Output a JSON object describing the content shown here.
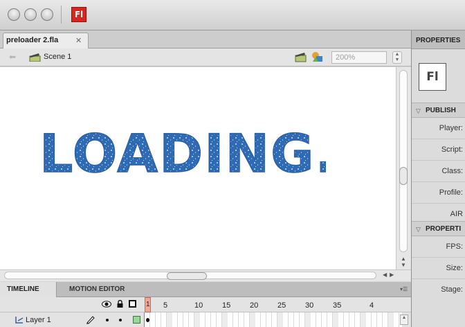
{
  "app": {
    "logo_text": "Fl"
  },
  "document": {
    "tab_name": "preloader 2.fla",
    "close_glyph": "✕"
  },
  "editbar": {
    "scene_label": "Scene 1",
    "zoom": "200%"
  },
  "stage": {
    "artwork_text": "LOADING...",
    "artwork_color": "#2f6bb5"
  },
  "timeline": {
    "tabs": [
      "TIMELINE",
      "MOTION EDITOR"
    ],
    "current_frame": "1",
    "frame_numbers": [
      "5",
      "10",
      "15",
      "20",
      "25",
      "30",
      "35",
      "4"
    ],
    "layers": [
      {
        "name": "Layer 1",
        "color": "#9cd49b"
      }
    ]
  },
  "panel": {
    "title": "PROPERTIES",
    "thumb_text": "Fl",
    "sections": [
      {
        "title": "PUBLISH",
        "rows": [
          "Player:",
          "Script:",
          "Class:",
          "Profile:",
          "AIR"
        ]
      },
      {
        "title": "PROPERTI",
        "rows": [
          "FPS:",
          "Size:",
          "Stage:"
        ]
      }
    ]
  }
}
